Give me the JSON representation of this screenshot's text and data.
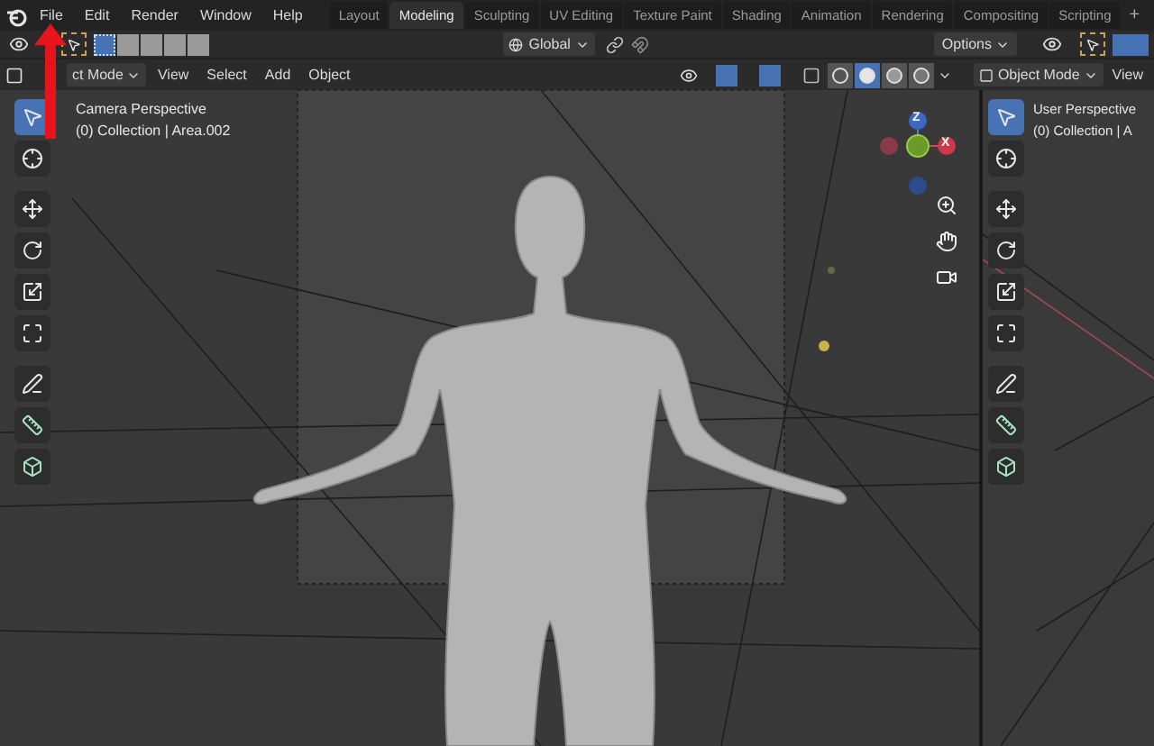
{
  "menu": [
    "File",
    "Edit",
    "Render",
    "Window",
    "Help"
  ],
  "workspace_tabs": [
    {
      "label": "Layout",
      "selected": false
    },
    {
      "label": "Modeling",
      "selected": true
    },
    {
      "label": "Sculpting",
      "selected": false
    },
    {
      "label": "UV Editing",
      "selected": false
    },
    {
      "label": "Texture Paint",
      "selected": false
    },
    {
      "label": "Shading",
      "selected": false
    },
    {
      "label": "Animation",
      "selected": false
    },
    {
      "label": "Rendering",
      "selected": false
    },
    {
      "label": "Compositing",
      "selected": false
    },
    {
      "label": "Scripting",
      "selected": false
    }
  ],
  "add_tab": "+",
  "tool_header": {
    "select_modes": [
      {
        "selected": true
      },
      {
        "selected": false
      },
      {
        "selected": false
      },
      {
        "selected": false
      },
      {
        "selected": false
      }
    ],
    "orientation": "Global",
    "options": "Options"
  },
  "viewport_header": {
    "mode": "ct Mode",
    "menus": [
      "View",
      "Select",
      "Add",
      "Object"
    ],
    "shading": [
      {
        "kind": "wireframe",
        "selected": false
      },
      {
        "kind": "solid",
        "selected": true
      },
      {
        "kind": "material",
        "selected": false
      },
      {
        "kind": "rendered",
        "selected": false
      }
    ]
  },
  "viewport": {
    "title": "Camera Perspective",
    "collection": "(0) Collection | Area.002",
    "gizmo_labels": [
      "Z",
      "X"
    ],
    "tools": [
      {
        "kind": "select",
        "selected": true
      },
      {
        "kind": "cursor",
        "selected": false
      },
      {
        "kind": "move",
        "selected": false
      },
      {
        "kind": "rotate",
        "selected": false
      },
      {
        "kind": "scale",
        "selected": false
      },
      {
        "kind": "transform",
        "selected": false
      },
      {
        "kind": "annotate",
        "selected": false
      },
      {
        "kind": "measure",
        "selected": false
      },
      {
        "kind": "add",
        "selected": false
      }
    ]
  },
  "right_viewport": {
    "mode": "Object Mode",
    "menus": [
      "View"
    ],
    "title": "User Perspective",
    "collection": "(0) Collection | A",
    "tools": [
      {
        "kind": "select",
        "selected": true
      },
      {
        "kind": "cursor",
        "selected": false
      },
      {
        "kind": "move",
        "selected": false
      },
      {
        "kind": "rotate",
        "selected": false
      },
      {
        "kind": "scale",
        "selected": false
      },
      {
        "kind": "transform",
        "selected": false
      },
      {
        "kind": "annotate",
        "selected": false
      },
      {
        "kind": "measure",
        "selected": false
      },
      {
        "kind": "add",
        "selected": false
      }
    ]
  }
}
